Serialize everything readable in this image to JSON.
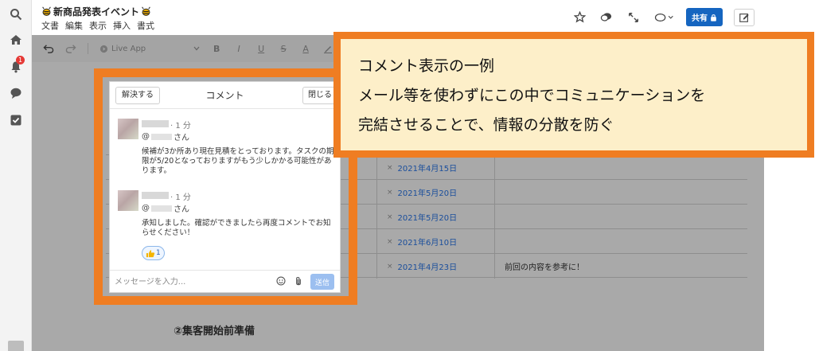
{
  "header": {
    "title": "新商品発表イベント",
    "menus": [
      "文書",
      "編集",
      "表示",
      "挿入",
      "書式"
    ],
    "share_label": "共有"
  },
  "toolbar": {
    "live_app_label": "Live App"
  },
  "rail": {
    "notification_count": "1"
  },
  "table": {
    "rows": [
      {
        "date": "2021年4月15日",
        "note": ""
      },
      {
        "date": "2021年5月20日",
        "note": ""
      },
      {
        "date": "2021年5月20日",
        "note": ""
      },
      {
        "date": "2021年6月10日",
        "note": ""
      },
      {
        "date": "2021年4月23日",
        "note": "前回の内容を参考に！"
      }
    ]
  },
  "section_heading": "②集客開始前準備",
  "callout": {
    "line1": "コメント表示の一例",
    "line2": "メール等を使わずにこの中でコミュニケーションを",
    "line3": "完結させることで、情報の分散を防ぐ"
  },
  "comments": {
    "resolve_label": "解決する",
    "title": "コメント",
    "close_label": "閉じる",
    "items": [
      {
        "time": "· 1 分",
        "mention_prefix": "@",
        "mention_suffix": "さん",
        "text": "候補が3か所あり現在見積をとっております。タスクの期限が5/20となっておりますがもう少しかかる可能性があります。"
      },
      {
        "time": "· 1 分",
        "mention_prefix": "@",
        "mention_suffix": "さん",
        "text": "承知しました。確認ができましたら再度コメントでお知らせください！",
        "reaction_count": "1"
      }
    ],
    "input_placeholder": "メッセージを入力...",
    "send_label": "送信"
  },
  "colors": {
    "accent_orange": "#ef7d22",
    "callout_bg": "#fdefc9",
    "share_blue": "#1565c0",
    "link_blue": "#1a4e9c"
  }
}
